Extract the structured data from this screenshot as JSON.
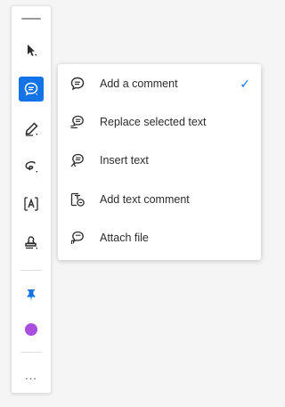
{
  "toolbar": {
    "tools": [
      {
        "name": "select-tool",
        "icon": "arrow-pointer-icon",
        "active": false
      },
      {
        "name": "add-comment-tool",
        "icon": "comment-bubble-icon",
        "active": true
      },
      {
        "name": "highlight-tool",
        "icon": "pen-icon",
        "active": false
      },
      {
        "name": "draw-tool",
        "icon": "lasso-icon",
        "active": false
      },
      {
        "name": "text-box-tool",
        "icon": "text-box-icon",
        "active": false
      },
      {
        "name": "stamp-tool",
        "icon": "stamp-icon",
        "active": false
      },
      {
        "name": "pin-tool",
        "icon": "pushpin-icon",
        "active": false
      }
    ],
    "color_swatch": "#a84fe0",
    "more_label": "...",
    "accent": "#1473e6"
  },
  "comment_menu": {
    "items": [
      {
        "label": "Add a comment",
        "icon": "comment-icon",
        "checked": true
      },
      {
        "label": "Replace selected text",
        "icon": "replace-text-icon",
        "checked": false
      },
      {
        "label": "Insert text",
        "icon": "insert-text-icon",
        "checked": false
      },
      {
        "label": "Add text comment",
        "icon": "text-comment-icon",
        "checked": false
      },
      {
        "label": "Attach file",
        "icon": "attach-file-icon",
        "checked": false
      }
    ]
  }
}
